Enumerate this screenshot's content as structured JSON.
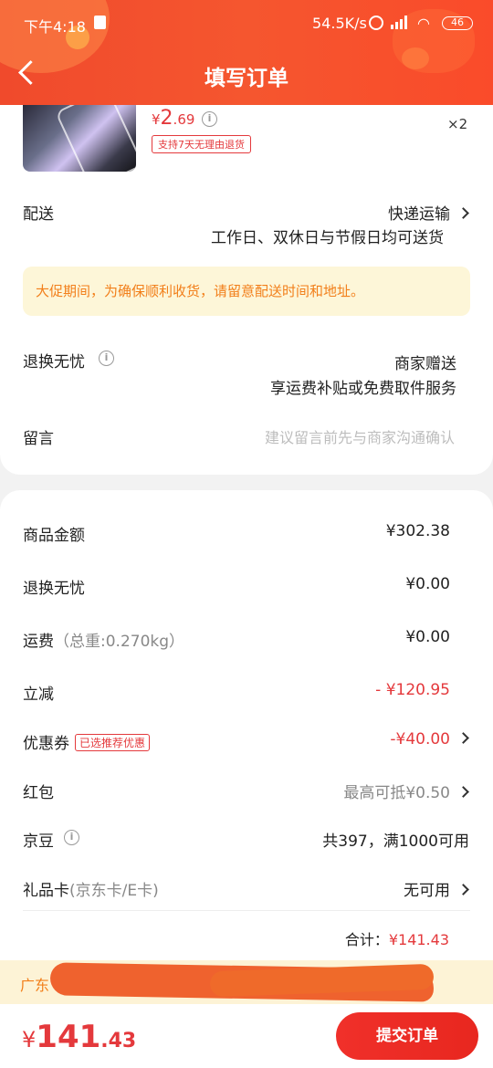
{
  "status_bar": {
    "time": "下午4:18",
    "net_rate": "54.5K/s",
    "battery": "46"
  },
  "header": {
    "title": "填写订单"
  },
  "product": {
    "price_symbol": "¥",
    "price_int": "2",
    "price_dec": ".69",
    "badge": "支持7天无理由退货",
    "quantity": "×2"
  },
  "delivery": {
    "label": "配送",
    "method": "快递运输",
    "note": "工作日、双休日与节假日均可送货"
  },
  "notice": "大促期间，为确保顺利收货，请留意配送时间和地址。",
  "returns": {
    "label": "退换无忧",
    "value": "商家赠送",
    "note": "享运费补贴或免费取件服务"
  },
  "remark": {
    "label": "留言",
    "placeholder": "建议留言前先与商家沟通确认"
  },
  "summary": {
    "goods_label": "商品金额",
    "goods_value": "¥302.38",
    "returns_label": "退换无忧",
    "returns_value": "¥0.00",
    "shipping_label": "运费",
    "shipping_weight": "（总重:0.270kg）",
    "shipping_value": "¥0.00",
    "discount_label": "立减",
    "discount_value": "- ¥120.95",
    "coupon_label": "优惠券",
    "coupon_tag": "已选推荐优惠",
    "coupon_value": "-¥40.00",
    "redpacket_label": "红包",
    "redpacket_value": "最高可抵¥0.50",
    "jd_bean_label": "京豆",
    "jd_bean_value": "共397，满1000可用",
    "giftcard_label": "礼品卡",
    "giftcard_sub": "(京东卡/E卡)",
    "giftcard_value": "无可用",
    "total_label": "合计：",
    "total_value": "¥141.43"
  },
  "address_bar": {
    "text": "广东"
  },
  "bottom": {
    "price_symbol": "¥",
    "price_int": "141",
    "price_dec": ".43",
    "submit_label": "提交订单"
  },
  "colors": {
    "brand_red": "#e4393c",
    "header_orange": "#f5562f",
    "notice_bg": "#fdf6d8",
    "notice_text": "#f27f1a"
  }
}
